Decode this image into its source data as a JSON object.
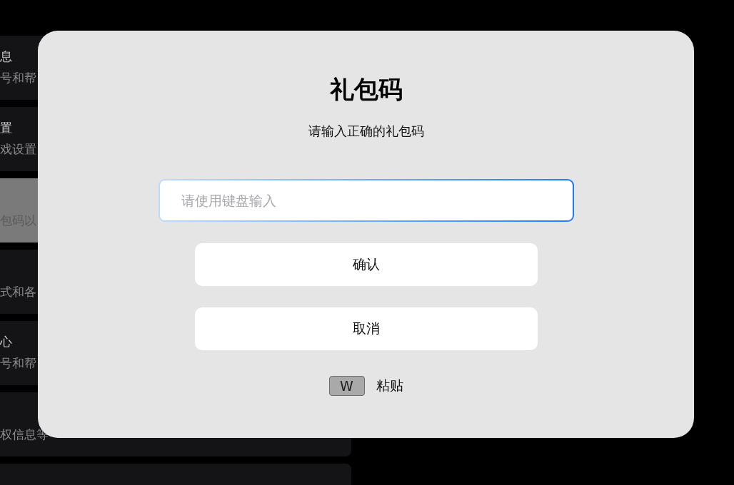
{
  "sidebar": {
    "items": [
      {
        "title": "息",
        "subtitle": "号和帮",
        "selected": false
      },
      {
        "title": "置",
        "subtitle": "戏设置",
        "selected": false
      },
      {
        "subtitle": "包码以",
        "selected": true
      },
      {
        "subtitle": "式和各",
        "selected": false
      },
      {
        "title": "心",
        "subtitle": "号和帮",
        "selected": false
      },
      {
        "subtitle": "权信息等",
        "selected": false
      },
      {
        "selected": false
      }
    ]
  },
  "dialog": {
    "title": "礼包码",
    "subtitle": "请输入正确的礼包码",
    "input": {
      "placeholder": "请使用键盘输入"
    },
    "buttons": [
      "确认",
      "取消"
    ],
    "hint": {
      "key": "W",
      "label": "粘贴"
    }
  }
}
